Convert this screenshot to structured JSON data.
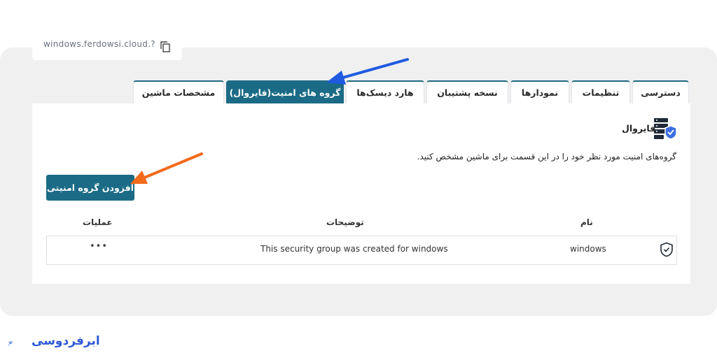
{
  "host": {
    "text": "windows.ferdowsi.cloud.???"
  },
  "tabs": [
    {
      "label": "دسترسی"
    },
    {
      "label": "تنظیمات"
    },
    {
      "label": "نمودارها"
    },
    {
      "label": "نسخه پشتیبان"
    },
    {
      "label": "هارد دیسک‌ها"
    },
    {
      "label": "گروه های امنیت(فایروال)",
      "active": true
    },
    {
      "label": "مشخصات ماشین"
    }
  ],
  "section": {
    "title": "فایروال",
    "description": "گروه‌های امنیت مورد نظر خود را در این قسمت برای ماشین مشخص کنید."
  },
  "add_button": {
    "label": "افزودن گروه امنیتی"
  },
  "table": {
    "headers": {
      "name": "نام",
      "description": "توضیحات",
      "actions": "عملیات"
    },
    "rows": [
      {
        "name": "windows",
        "description": "This security group was created for windows",
        "actions": "•••"
      }
    ]
  },
  "brand": {
    "name": "ابرفردوسی"
  },
  "colors": {
    "accent": "#1b6b86",
    "brand": "#2d58d6",
    "arrow_blue": "#1f5ae0",
    "arrow_orange": "#f26a1b"
  }
}
